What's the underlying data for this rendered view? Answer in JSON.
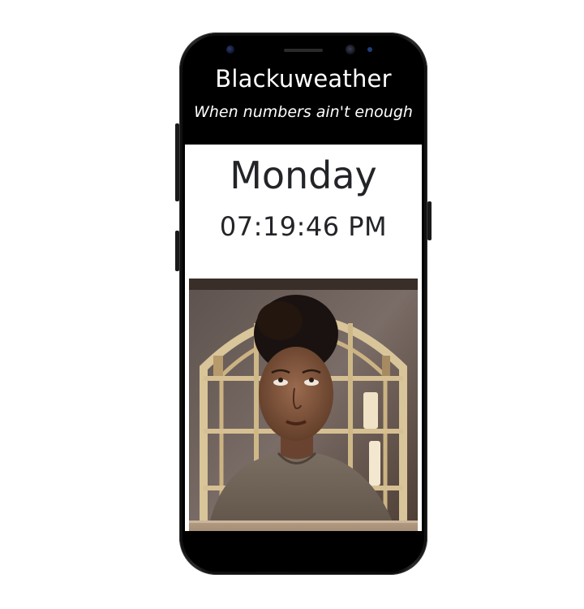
{
  "app": {
    "title": "Blackuweather",
    "tagline": "When numbers ain't enough"
  },
  "clock": {
    "day": "Monday",
    "time": "07:19:46 PM"
  },
  "image": {
    "icon": "photo-of-woman-rolling-eyes"
  },
  "colors": {
    "header_bg": "#000000",
    "header_text": "#ffffff",
    "content_bg": "#ffffff",
    "clock_text": "#222428"
  }
}
